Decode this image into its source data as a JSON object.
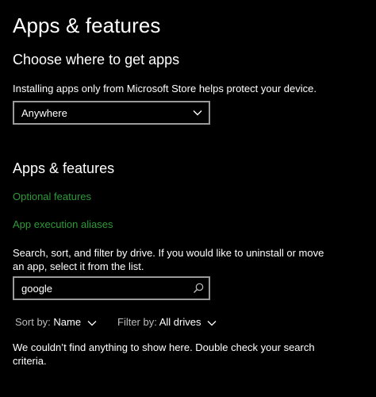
{
  "page": {
    "title": "Apps & features"
  },
  "choose_section": {
    "heading": "Choose where to get apps",
    "description": "Installing apps only from Microsoft Store helps protect your device.",
    "dropdown_value": "Anywhere"
  },
  "apps_section": {
    "heading": "Apps & features",
    "optional_features_link": "Optional features",
    "execution_aliases_link": "App execution aliases",
    "description": "Search, sort, and filter by drive. If you would like to uninstall or move an app, select it from the list.",
    "search_value": "google",
    "sort_label": "Sort by:",
    "sort_value": "Name",
    "filter_label": "Filter by:",
    "filter_value": "All drives",
    "empty_message": "We couldn’t find anything to show here. Double check your search criteria."
  },
  "colors": {
    "background": "#000000",
    "text": "#ffffff",
    "link": "#2e9a39",
    "border": "#9a9a9a"
  },
  "icons": {
    "dropdown": "chevron-down-icon",
    "search": "search-icon"
  }
}
